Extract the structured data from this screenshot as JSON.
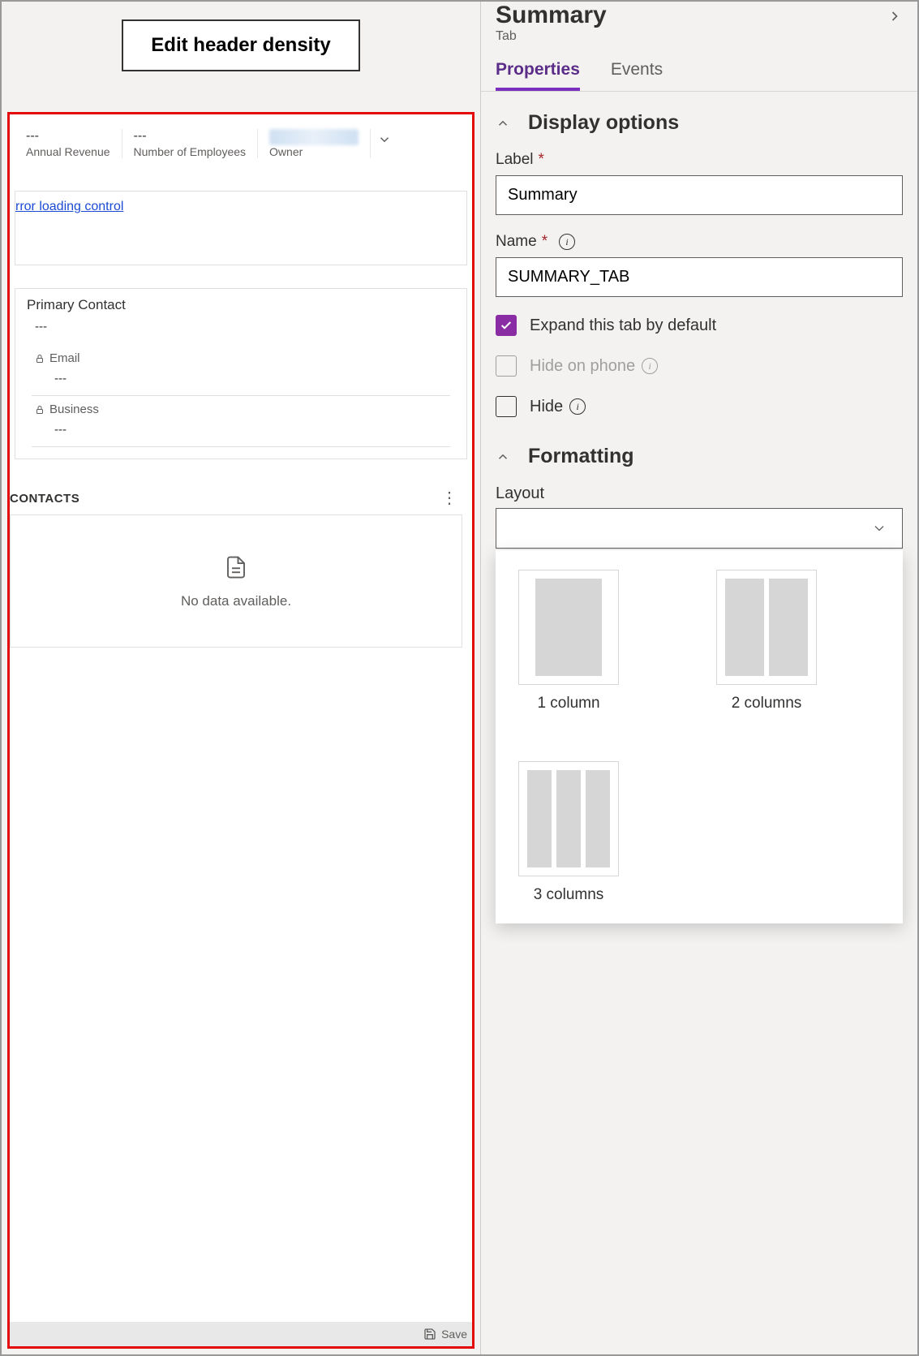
{
  "leftPane": {
    "editHeaderBtn": "Edit header density",
    "header": {
      "annualRevenue": {
        "value": "---",
        "label": "Annual Revenue"
      },
      "employees": {
        "value": "---",
        "label": "Number of Employees"
      },
      "owner": {
        "label": "Owner"
      }
    },
    "errorCard": "rror loading control",
    "primaryContact": {
      "title": "Primary Contact",
      "value": "---",
      "email": {
        "label": "Email",
        "value": "---"
      },
      "business": {
        "label": "Business",
        "value": "---"
      }
    },
    "contacts": {
      "title": "CONTACTS",
      "noData": "No data available."
    },
    "statusBar": {
      "save": "Save"
    }
  },
  "rightPane": {
    "title": "Summary",
    "subtitle": "Tab",
    "tabs": {
      "properties": "Properties",
      "events": "Events"
    },
    "displayOptions": {
      "section": "Display options",
      "labelField": {
        "label": "Label",
        "value": "Summary"
      },
      "nameField": {
        "label": "Name",
        "value": "SUMMARY_TAB"
      },
      "expandDefault": "Expand this tab by default",
      "hidePhone": "Hide on phone",
      "hide": "Hide"
    },
    "formatting": {
      "section": "Formatting",
      "layoutLabel": "Layout",
      "options": {
        "one": "1 column",
        "two": "2 columns",
        "three": "3 columns"
      }
    }
  }
}
